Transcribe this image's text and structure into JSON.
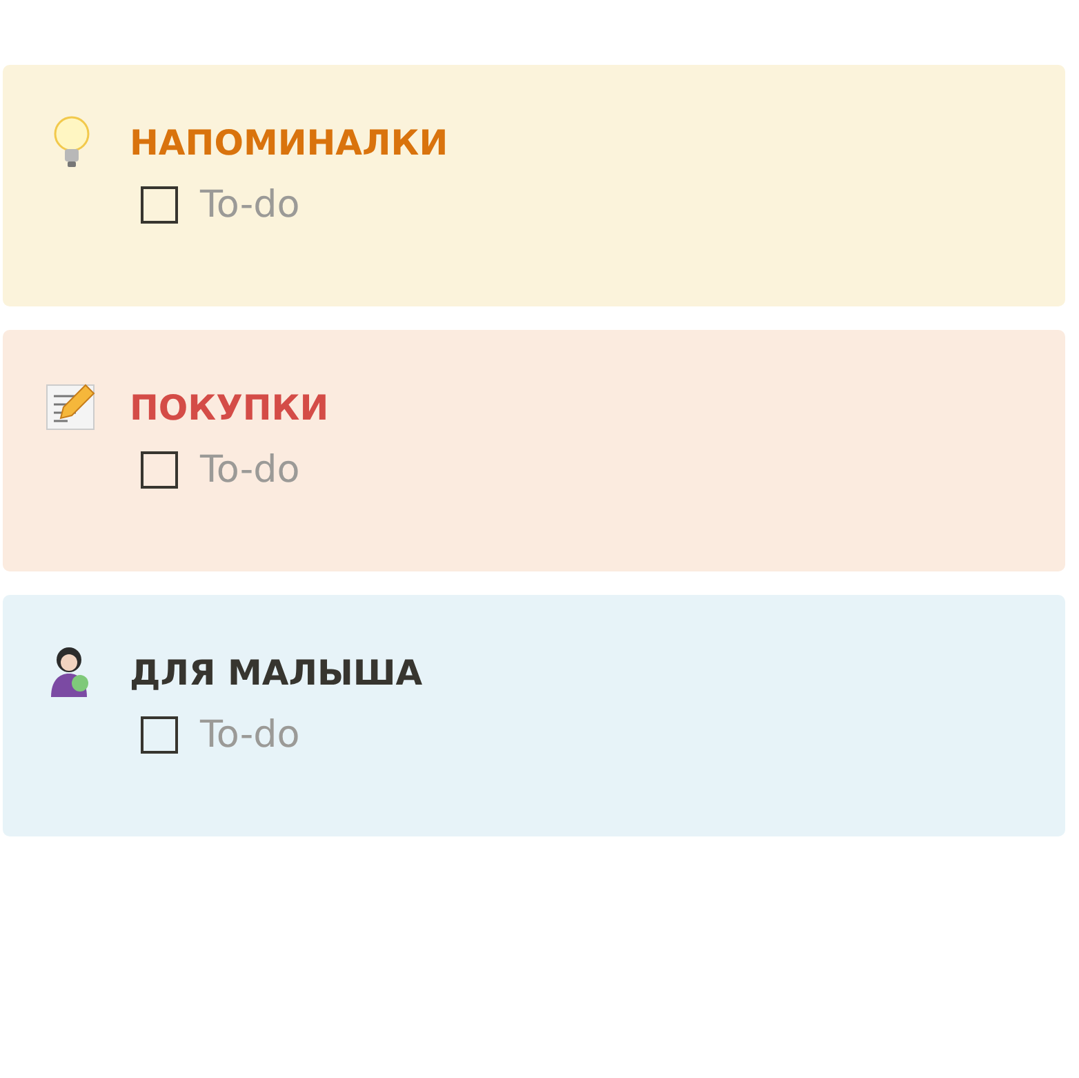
{
  "cards": [
    {
      "color": "#fbf3db",
      "title": {
        "text": "НАПОМИНАЛКИ",
        "color": "#d9730d"
      },
      "todos": [
        {
          "label": "To-do",
          "checked": false
        }
      ]
    },
    {
      "color": "#fbebdf",
      "title": {
        "text": "ПОКУПКИ",
        "color": "#d44c47"
      },
      "todos": [
        {
          "label": "To-do",
          "checked": false
        }
      ]
    },
    {
      "color": "#e7f3f8",
      "title": {
        "text": "ДЛЯ МАЛЫША",
        "color": "#37352f"
      },
      "todos": [
        {
          "label": "To-do",
          "checked": false
        }
      ]
    }
  ]
}
